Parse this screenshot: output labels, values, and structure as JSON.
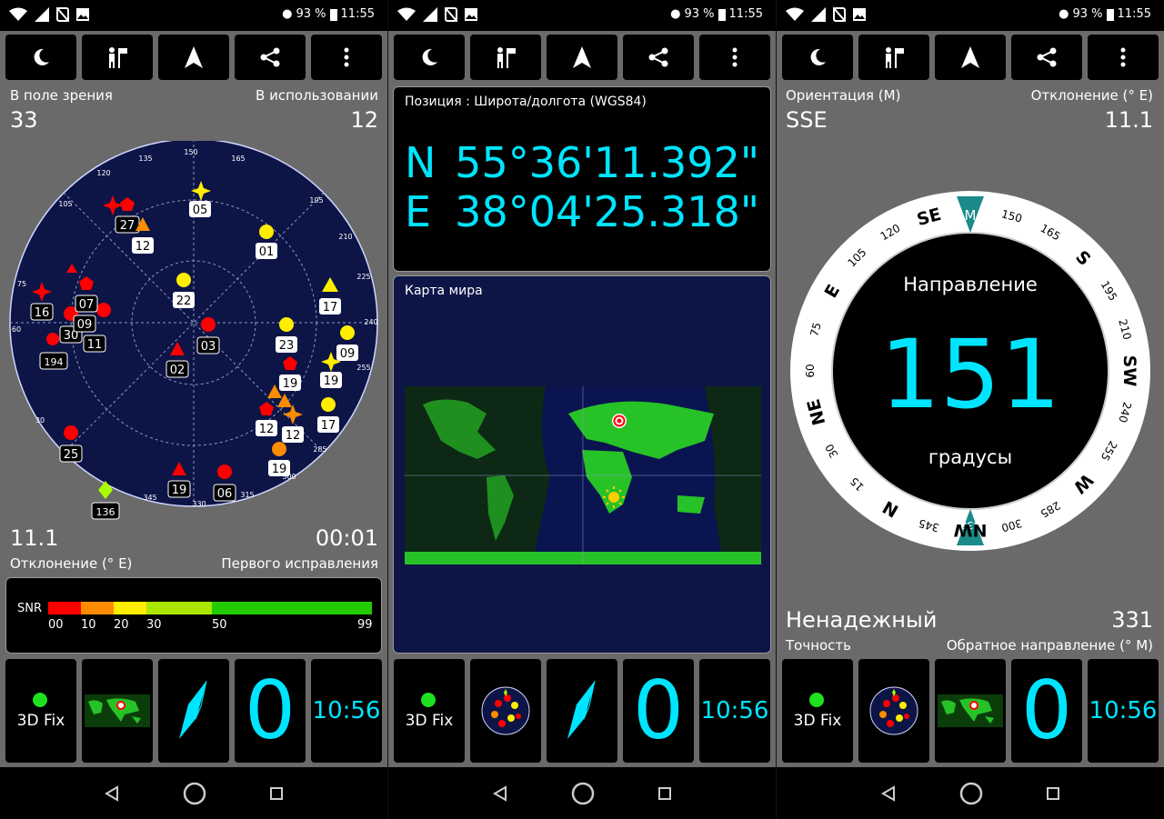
{
  "status": {
    "battery": "93 %",
    "time": "11:55"
  },
  "colors": {
    "cyan": "#00e5ff",
    "panel_bg": "#6a6a6a",
    "sky": "#0d1547",
    "red": "#ff0000",
    "yellow": "#ffee00",
    "orange": "#ff8c00"
  },
  "toolbar": {
    "icons": [
      "moon-icon",
      "person-flag-icon",
      "navigate-arrow-icon",
      "share-icon",
      "more-vert-icon"
    ]
  },
  "sky": {
    "in_view_label": "В поле зрения",
    "in_view": "33",
    "in_use_label": "В использовании",
    "in_use": "12",
    "azimuth_ticks": [
      "150",
      "165",
      "195",
      "210",
      "225",
      "240",
      "255",
      "285",
      "300",
      "315",
      "330",
      "345",
      "30",
      "60",
      "75",
      "105",
      "120",
      "135"
    ],
    "declination": "11.1",
    "declination_label": "Отклонение (° E)",
    "ttff": "00:01",
    "ttff_label": "Первого исправления",
    "satellites": [
      {
        "id": "05",
        "shape": "star",
        "color": "#ffee00",
        "az": 160,
        "el": 0.1
      },
      {
        "id": "01",
        "color": "#ffee00"
      },
      {
        "id": "17",
        "shape": "triangle",
        "color": "#ffee00"
      },
      {
        "id": "22",
        "color": "#ffee00"
      },
      {
        "id": "23",
        "color": "#ffee00"
      },
      {
        "id": "09",
        "color": "#ffee00"
      },
      {
        "id": "19",
        "shape": "star",
        "color": "#ffee00"
      },
      {
        "id": "17",
        "color": "#ffee00"
      },
      {
        "id": "03",
        "color": "#ff0000"
      },
      {
        "id": "02",
        "shape": "triangle",
        "color": "#ff0000"
      },
      {
        "id": "19",
        "shape": "pentagon",
        "color": "#ff0000"
      },
      {
        "id": "12",
        "shape": "triangle",
        "color": "#ff8c00"
      },
      {
        "id": "12",
        "shape": "pentagon",
        "color": "#ff0000"
      },
      {
        "id": "12",
        "shape": "star",
        "color": "#ff8c00"
      },
      {
        "id": "19",
        "color": "#ff8c00"
      },
      {
        "id": "19",
        "shape": "triangle",
        "color": "#ff0000"
      },
      {
        "id": "06",
        "color": "#ff0000"
      },
      {
        "id": "25",
        "color": "#ff0000"
      },
      {
        "id": "136",
        "shape": "diamond",
        "color": "#aaff00"
      },
      {
        "id": "16",
        "shape": "star",
        "color": "#ff0000"
      },
      {
        "id": "30",
        "color": "#ff0000"
      },
      {
        "id": "11",
        "color": "#ff0000"
      },
      {
        "id": "194",
        "color": "#ff0000"
      },
      {
        "id": "07",
        "shape": "pentagon",
        "color": "#ff0000"
      },
      {
        "id": "09",
        "color": "#ff0000"
      },
      {
        "id": "27",
        "shape": "pentagon",
        "color": "#ff0000"
      },
      {
        "id": "12",
        "shape": "triangle",
        "color": "#ff8c00"
      }
    ],
    "snr": {
      "label": "SNR",
      "ticks": [
        "00",
        "10",
        "20",
        "30",
        "50",
        "99"
      ]
    }
  },
  "position": {
    "header": "Позиция : Широта/долгота (WGS84)",
    "lat_hemi": "N",
    "lat": "55°36'11.392\"",
    "lon_hemi": "E",
    "lon": "38°04'25.318\""
  },
  "world_map": {
    "header": "Карта мира"
  },
  "compass": {
    "orientation_label": "Ориентация (M)",
    "orientation": "SSE",
    "declination_label": "Отклонение (° E)",
    "declination": "11.1",
    "heading_label": "Направление",
    "heading": "151",
    "units": "градусы",
    "accuracy": "Ненадежный",
    "accuracy_label": "Точность",
    "reverse": "331",
    "reverse_label": "Обратное направление (° M)",
    "marker_top": "M",
    "marker_bottom": "330",
    "dial_labels": [
      "150",
      "165",
      "S",
      "195",
      "210",
      "SW",
      "240",
      "255",
      "W",
      "285",
      "300",
      "NW",
      "345",
      "N",
      "15",
      "30",
      "NE",
      "60",
      "75",
      "E",
      "105",
      "120",
      "SE"
    ]
  },
  "tiles": {
    "fix": "3D Fix",
    "count": "0",
    "time": "10:56"
  }
}
